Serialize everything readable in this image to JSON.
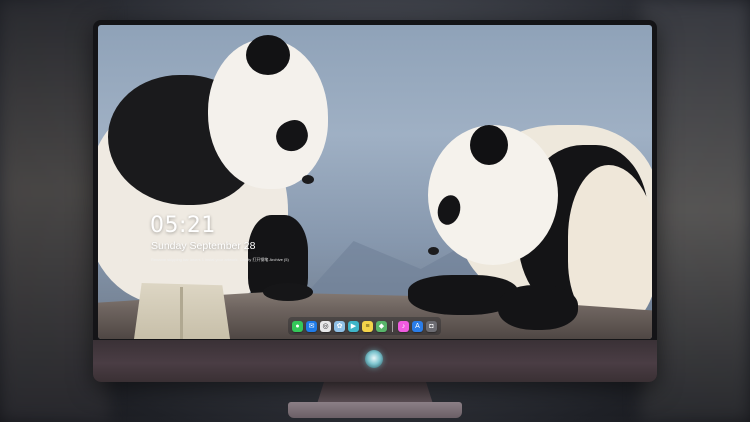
{
  "lockscreen": {
    "time": "05:21",
    "date": "Sunday September  28",
    "notice": "Rename skipping bar lasers 1 instal your artwork. Crusty  打开钢笔   Archive (5)"
  },
  "dock": {
    "items": [
      {
        "icon": "messages-icon",
        "glyph": "●",
        "color": "#34c759"
      },
      {
        "icon": "mail-icon",
        "glyph": "✉",
        "color": "#1f7be8"
      },
      {
        "icon": "safari-icon",
        "glyph": "◎",
        "color": "#e8e8ea"
      },
      {
        "icon": "photos-icon",
        "glyph": "✿",
        "color": "#8fc0e6"
      },
      {
        "icon": "video-editor-icon",
        "glyph": "▶",
        "color": "#3fb5c8"
      },
      {
        "icon": "notes-icon",
        "glyph": "≡",
        "color": "#f4d44a"
      },
      {
        "icon": "maps-icon",
        "glyph": "◆",
        "color": "#58b56a"
      },
      {
        "icon": "music-icon",
        "glyph": "♪",
        "color": "#f05be0"
      },
      {
        "icon": "app-store-icon",
        "glyph": "A",
        "color": "#2a7de8"
      },
      {
        "icon": "camera-icon",
        "glyph": "◘",
        "color": "#6c6c72"
      }
    ]
  },
  "colors": {
    "monitor_bezel": "#141417",
    "monitor_chin": "#4a3d44",
    "wallpaper_sky": "#9fb0c4"
  }
}
